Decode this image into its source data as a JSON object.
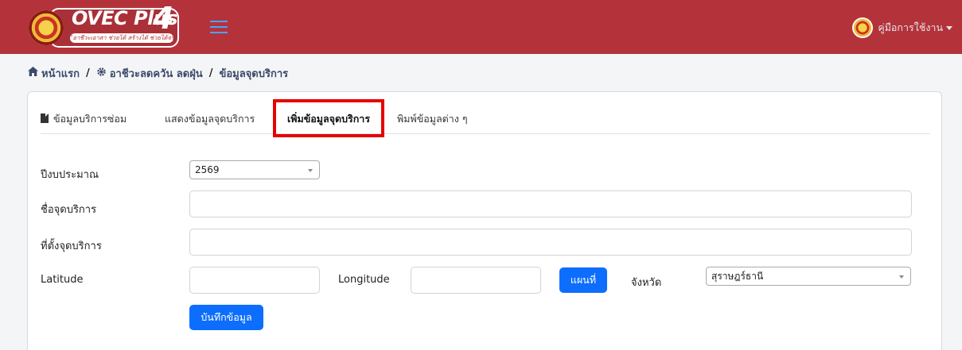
{
  "app": {
    "logo_text": "OVEC Plus",
    "logo_number": "4",
    "logo_tagline": "\"อาชีวะเอาสา ช่วยได้ สร้างได้ ช่วยได้จริง\""
  },
  "header": {
    "user_menu_label": "คู่มือการใช้งาน"
  },
  "breadcrumb": {
    "home": "หน้าแรก",
    "section": "อาชีวะลดควัน ลดฝุ่น",
    "current": "ข้อมูลจุดบริการ",
    "separator": "/"
  },
  "tabs": [
    {
      "label": "ข้อมูลบริการซ่อม"
    },
    {
      "label": "แสดงข้อมูลจุดบริการ"
    },
    {
      "label": "เพิ่มข้อมูลจุดบริการ",
      "active": true
    },
    {
      "label": "พิมพ์ข้อมูลต่าง ๆ"
    }
  ],
  "form": {
    "year_label": "ปีงบประมาณ",
    "year_value": "2569",
    "name_label": "ชื่อจุดบริการ",
    "name_value": "",
    "location_label": "ที่ตั้งจุดบริการ",
    "location_value": "",
    "lat_label": "Latitude",
    "lat_value": "",
    "lng_label": "Longitude",
    "lng_value": "",
    "map_button": "แผนที่",
    "province_label": "จังหวัด",
    "province_value": "สุราษฎร์ธานี",
    "save_button": "บันทึกข้อมูล"
  },
  "colors": {
    "navbar": "#b4333a",
    "primary": "#0d6efd",
    "highlight": "#e60000"
  }
}
